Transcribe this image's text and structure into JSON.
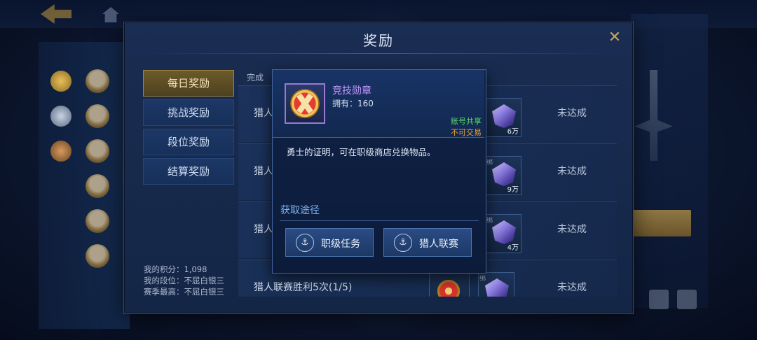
{
  "dialog": {
    "title": "奖励",
    "close_icon": "close-icon"
  },
  "tabs": [
    {
      "label": "每日奖励",
      "active": true
    },
    {
      "label": "挑战奖励",
      "active": false
    },
    {
      "label": "段位奖励",
      "active": false
    },
    {
      "label": "结算奖励",
      "active": false
    }
  ],
  "stats": {
    "points": "我的积分：1,098",
    "rank": "我的段位：不屈白银三",
    "season_best": "赛季最高：不屈白银三"
  },
  "task_list": {
    "header": "完成",
    "rows": [
      {
        "name": "猎人",
        "rewards": [
          {
            "type": "gem",
            "count": "6万",
            "bind": ""
          }
        ],
        "status": "未达成"
      },
      {
        "name": "猎人",
        "rewards": [
          {
            "type": "gem",
            "count": "9万",
            "bind": "绑"
          }
        ],
        "status": "未达成"
      },
      {
        "name": "猎人",
        "rewards": [
          {
            "type": "gem",
            "count": "4万",
            "bind": "绑"
          }
        ],
        "status": "未达成"
      },
      {
        "name": "猎人联赛胜利5次(1/5)",
        "rewards": [
          {
            "type": "medal",
            "count": ""
          },
          {
            "type": "gem",
            "count": "",
            "bind": "绑"
          }
        ],
        "status": "未达成"
      }
    ]
  },
  "tooltip": {
    "item_name": "竞技勋章",
    "owned": "拥有：160",
    "flag_shared": "账号共享",
    "flag_trade": "不可交易",
    "description": "勇士的证明，可在职级商店兑换物品。",
    "source_title": "获取途径",
    "buttons": [
      {
        "label": "职级任务",
        "icon": "trident-icon"
      },
      {
        "label": "猎人联赛",
        "icon": "trident-icon"
      }
    ],
    "colors": {
      "name": "#c89bff",
      "shared": "#5bdc6a",
      "trade": "#e8a23b",
      "source": "#7fb4f0"
    }
  }
}
